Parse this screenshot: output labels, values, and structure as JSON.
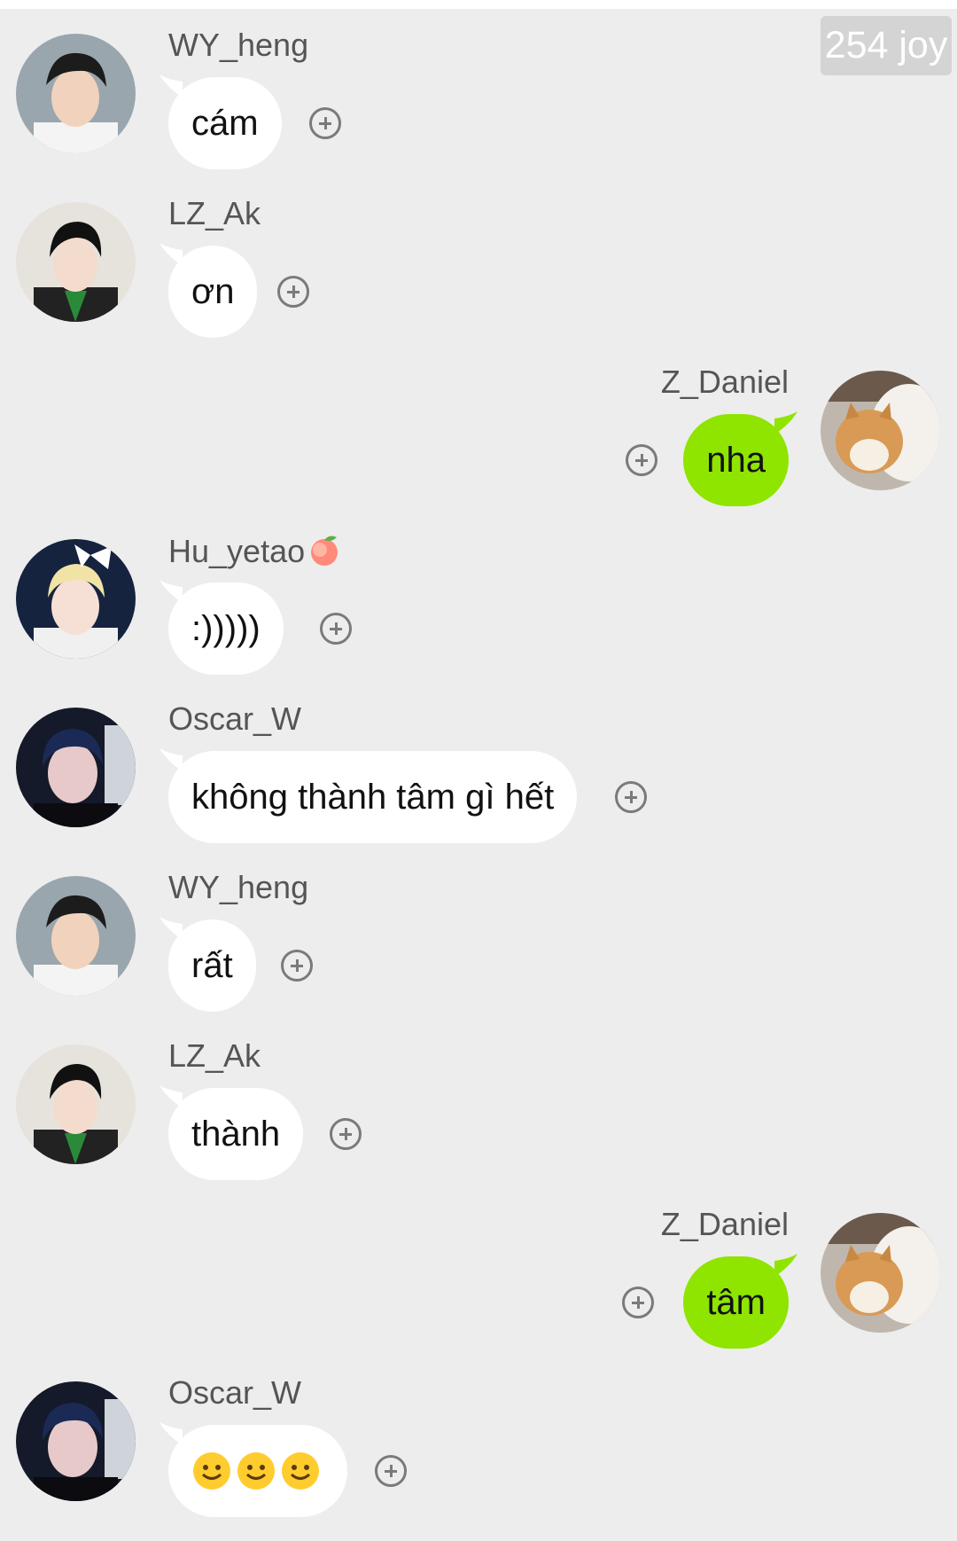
{
  "badge": {
    "text": "254 joy"
  },
  "messages": [
    {
      "sender": "WY_heng",
      "text": "cám",
      "side": "left",
      "avatar": "avatar-wy-heng"
    },
    {
      "sender": "LZ_Ak",
      "text": "ơn",
      "side": "left",
      "avatar": "avatar-lz-ak"
    },
    {
      "sender": "Z_Daniel",
      "text": "nha",
      "side": "right",
      "avatar": "avatar-cat"
    },
    {
      "sender": "Hu_yetao",
      "sender_emoji": "peach-emoji",
      "text": ":)))))",
      "side": "left",
      "avatar": "avatar-hu-yetao"
    },
    {
      "sender": "Oscar_W",
      "text": "không thành tâm gì hết",
      "side": "left",
      "avatar": "avatar-oscar-w"
    },
    {
      "sender": "WY_heng",
      "text": "rất",
      "side": "left",
      "avatar": "avatar-wy-heng"
    },
    {
      "sender": "LZ_Ak",
      "text": "thành",
      "side": "left",
      "avatar": "avatar-lz-ak"
    },
    {
      "sender": "Z_Daniel",
      "text": "tâm",
      "side": "right",
      "avatar": "avatar-cat"
    },
    {
      "sender": "Oscar_W",
      "text": "",
      "emojis": [
        "smiley-emoji",
        "smiley-emoji",
        "smiley-emoji"
      ],
      "side": "left",
      "avatar": "avatar-oscar-w"
    }
  ],
  "colors": {
    "background": "#ededed",
    "incoming_bubble": "#ffffff",
    "outgoing_bubble": "#8fe400",
    "badge": "#d4d4d4"
  },
  "icons": {
    "reaction": "add-reaction-icon"
  }
}
